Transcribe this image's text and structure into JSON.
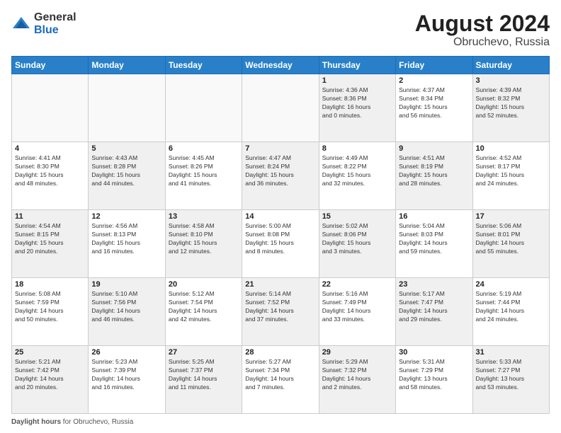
{
  "logo": {
    "general": "General",
    "blue": "Blue"
  },
  "title": {
    "month_year": "August 2024",
    "location": "Obruchevo, Russia"
  },
  "days_of_week": [
    "Sunday",
    "Monday",
    "Tuesday",
    "Wednesday",
    "Thursday",
    "Friday",
    "Saturday"
  ],
  "weeks": [
    [
      {
        "day": "",
        "info": ""
      },
      {
        "day": "",
        "info": ""
      },
      {
        "day": "",
        "info": ""
      },
      {
        "day": "",
        "info": ""
      },
      {
        "day": "1",
        "info": "Sunrise: 4:36 AM\nSunset: 8:36 PM\nDaylight: 16 hours\nand 0 minutes."
      },
      {
        "day": "2",
        "info": "Sunrise: 4:37 AM\nSunset: 8:34 PM\nDaylight: 15 hours\nand 56 minutes."
      },
      {
        "day": "3",
        "info": "Sunrise: 4:39 AM\nSunset: 8:32 PM\nDaylight: 15 hours\nand 52 minutes."
      }
    ],
    [
      {
        "day": "4",
        "info": "Sunrise: 4:41 AM\nSunset: 8:30 PM\nDaylight: 15 hours\nand 48 minutes."
      },
      {
        "day": "5",
        "info": "Sunrise: 4:43 AM\nSunset: 8:28 PM\nDaylight: 15 hours\nand 44 minutes."
      },
      {
        "day": "6",
        "info": "Sunrise: 4:45 AM\nSunset: 8:26 PM\nDaylight: 15 hours\nand 41 minutes."
      },
      {
        "day": "7",
        "info": "Sunrise: 4:47 AM\nSunset: 8:24 PM\nDaylight: 15 hours\nand 36 minutes."
      },
      {
        "day": "8",
        "info": "Sunrise: 4:49 AM\nSunset: 8:22 PM\nDaylight: 15 hours\nand 32 minutes."
      },
      {
        "day": "9",
        "info": "Sunrise: 4:51 AM\nSunset: 8:19 PM\nDaylight: 15 hours\nand 28 minutes."
      },
      {
        "day": "10",
        "info": "Sunrise: 4:52 AM\nSunset: 8:17 PM\nDaylight: 15 hours\nand 24 minutes."
      }
    ],
    [
      {
        "day": "11",
        "info": "Sunrise: 4:54 AM\nSunset: 8:15 PM\nDaylight: 15 hours\nand 20 minutes."
      },
      {
        "day": "12",
        "info": "Sunrise: 4:56 AM\nSunset: 8:13 PM\nDaylight: 15 hours\nand 16 minutes."
      },
      {
        "day": "13",
        "info": "Sunrise: 4:58 AM\nSunset: 8:10 PM\nDaylight: 15 hours\nand 12 minutes."
      },
      {
        "day": "14",
        "info": "Sunrise: 5:00 AM\nSunset: 8:08 PM\nDaylight: 15 hours\nand 8 minutes."
      },
      {
        "day": "15",
        "info": "Sunrise: 5:02 AM\nSunset: 8:06 PM\nDaylight: 15 hours\nand 3 minutes."
      },
      {
        "day": "16",
        "info": "Sunrise: 5:04 AM\nSunset: 8:03 PM\nDaylight: 14 hours\nand 59 minutes."
      },
      {
        "day": "17",
        "info": "Sunrise: 5:06 AM\nSunset: 8:01 PM\nDaylight: 14 hours\nand 55 minutes."
      }
    ],
    [
      {
        "day": "18",
        "info": "Sunrise: 5:08 AM\nSunset: 7:59 PM\nDaylight: 14 hours\nand 50 minutes."
      },
      {
        "day": "19",
        "info": "Sunrise: 5:10 AM\nSunset: 7:56 PM\nDaylight: 14 hours\nand 46 minutes."
      },
      {
        "day": "20",
        "info": "Sunrise: 5:12 AM\nSunset: 7:54 PM\nDaylight: 14 hours\nand 42 minutes."
      },
      {
        "day": "21",
        "info": "Sunrise: 5:14 AM\nSunset: 7:52 PM\nDaylight: 14 hours\nand 37 minutes."
      },
      {
        "day": "22",
        "info": "Sunrise: 5:16 AM\nSunset: 7:49 PM\nDaylight: 14 hours\nand 33 minutes."
      },
      {
        "day": "23",
        "info": "Sunrise: 5:17 AM\nSunset: 7:47 PM\nDaylight: 14 hours\nand 29 minutes."
      },
      {
        "day": "24",
        "info": "Sunrise: 5:19 AM\nSunset: 7:44 PM\nDaylight: 14 hours\nand 24 minutes."
      }
    ],
    [
      {
        "day": "25",
        "info": "Sunrise: 5:21 AM\nSunset: 7:42 PM\nDaylight: 14 hours\nand 20 minutes."
      },
      {
        "day": "26",
        "info": "Sunrise: 5:23 AM\nSunset: 7:39 PM\nDaylight: 14 hours\nand 16 minutes."
      },
      {
        "day": "27",
        "info": "Sunrise: 5:25 AM\nSunset: 7:37 PM\nDaylight: 14 hours\nand 11 minutes."
      },
      {
        "day": "28",
        "info": "Sunrise: 5:27 AM\nSunset: 7:34 PM\nDaylight: 14 hours\nand 7 minutes."
      },
      {
        "day": "29",
        "info": "Sunrise: 5:29 AM\nSunset: 7:32 PM\nDaylight: 14 hours\nand 2 minutes."
      },
      {
        "day": "30",
        "info": "Sunrise: 5:31 AM\nSunset: 7:29 PM\nDaylight: 13 hours\nand 58 minutes."
      },
      {
        "day": "31",
        "info": "Sunrise: 5:33 AM\nSunset: 7:27 PM\nDaylight: 13 hours\nand 53 minutes."
      }
    ]
  ],
  "footer": {
    "label": "Daylight hours",
    "text": " for Obruchevo, Russia"
  }
}
